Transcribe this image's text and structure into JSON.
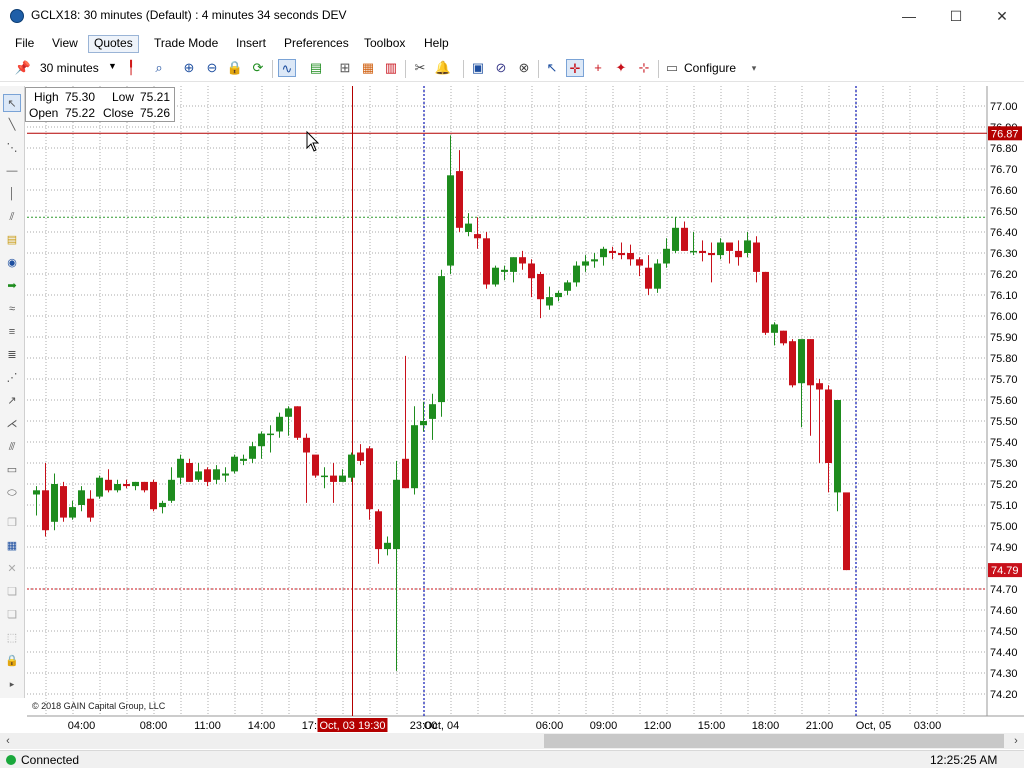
{
  "window": {
    "title": "GCLX18: 30 minutes (Default) : 4 minutes 34 seconds DEV",
    "minimize": "—",
    "maximize": "☐",
    "close": "✕"
  },
  "menu": [
    "File",
    "View",
    "Quotes",
    "Trade Mode",
    "Insert",
    "Preferences",
    "Toolbox",
    "Help"
  ],
  "menu_active": "Quotes",
  "toolbar": {
    "timeframe": "30 minutes",
    "configure_label": "Configure",
    "icons": [
      "pin-icon",
      "bar-type-icon",
      "zoom-icon",
      "zoom-in-icon",
      "zoom-out-icon",
      "lock-icon",
      "refresh-icon",
      "indicator-icon",
      "chart-type-icon",
      "tree-icon",
      "color-bars-icon",
      "bar-chart-icon",
      "scissors-icon",
      "alert-bell-icon",
      "book-icon",
      "link-icon",
      "unlink-icon",
      "cursor-icon",
      "crosshair-icon",
      "crosshair-alt-icon",
      "marker-icon",
      "cross-icon",
      "configure-icon"
    ]
  },
  "left_tools": [
    "select-icon",
    "line-icon",
    "parallel-line-icon",
    "horizontal-line-icon",
    "vertical-line-icon",
    "channel-icon",
    "note-icon",
    "callout-icon",
    "arrow-icon",
    "wave-icon",
    "fib-icon",
    "text-icon",
    "pitchfork-icon",
    "ray-icon",
    "gann-icon",
    "parallel-icon",
    "rectangle-icon",
    "ellipse-icon",
    "layers-icon",
    "properties-icon",
    "delete-icon",
    "copy-icon",
    "copy-all-icon",
    "select-all-icon",
    "lock-icon",
    "expand-icon"
  ],
  "ohlc": {
    "high_label": "High",
    "high": "75.30",
    "low_label": "Low",
    "low": "75.21",
    "open_label": "Open",
    "open": "75.22",
    "close_label": "Close",
    "close": "75.26"
  },
  "copyright": "© 2018 GAIN Capital Group, LLC",
  "status": {
    "connection": "Connected",
    "clock": "12:25:25 AM"
  },
  "colors": {
    "up": "#1e8c1e",
    "down": "#c8101a",
    "grid": "#8c8c8c",
    "price_tag": "#c8101a",
    "day_divider": "#0a14b4",
    "cursor_tag": "#b40000"
  },
  "chart_data": {
    "type": "candlestick",
    "symbol": "GCLX18",
    "interval": "30 minutes",
    "ylim": [
      74.15,
      77.05
    ],
    "y_ticks": [
      77.0,
      76.9,
      76.8,
      76.7,
      76.6,
      76.5,
      76.4,
      76.3,
      76.2,
      76.1,
      76.0,
      75.9,
      75.8,
      75.7,
      75.6,
      75.5,
      75.4,
      75.3,
      75.2,
      75.1,
      75.0,
      74.9,
      74.8,
      74.7,
      74.6,
      74.5,
      74.4,
      74.3,
      74.2
    ],
    "x_ticks": [
      {
        "label": "04:00",
        "bar": 5
      },
      {
        "label": "08:00",
        "bar": 13
      },
      {
        "label": "11:00",
        "bar": 19
      },
      {
        "label": "14:00",
        "bar": 25
      },
      {
        "label": "17:00",
        "bar": 31
      },
      {
        "label": "23:00",
        "bar": 43
      },
      {
        "label": "Oct, 04",
        "bar": 45
      },
      {
        "label": "06:00",
        "bar": 57
      },
      {
        "label": "09:00",
        "bar": 63
      },
      {
        "label": "12:00",
        "bar": 69
      },
      {
        "label": "15:00",
        "bar": 75
      },
      {
        "label": "18:00",
        "bar": 81
      },
      {
        "label": "21:00",
        "bar": 87
      },
      {
        "label": "Oct, 05",
        "bar": 93
      },
      {
        "label": "03:00",
        "bar": 99
      }
    ],
    "candles": [
      [
        75.15,
        75.19,
        75.05,
        75.17
      ],
      [
        75.17,
        75.3,
        74.95,
        74.98
      ],
      [
        75.02,
        75.25,
        74.98,
        75.2
      ],
      [
        75.19,
        75.21,
        75.02,
        75.04
      ],
      [
        75.04,
        75.12,
        75.03,
        75.09
      ],
      [
        75.1,
        75.19,
        75.07,
        75.17
      ],
      [
        75.13,
        75.17,
        75.02,
        75.04
      ],
      [
        75.14,
        75.24,
        75.13,
        75.23
      ],
      [
        75.22,
        75.27,
        75.16,
        75.17
      ],
      [
        75.17,
        75.22,
        75.16,
        75.2
      ],
      [
        75.2,
        75.22,
        75.18,
        75.19
      ],
      [
        75.19,
        75.21,
        75.17,
        75.21
      ],
      [
        75.21,
        75.21,
        75.16,
        75.17
      ],
      [
        75.21,
        75.22,
        75.07,
        75.08
      ],
      [
        75.09,
        75.12,
        75.06,
        75.11
      ],
      [
        75.12,
        75.28,
        75.11,
        75.22
      ],
      [
        75.23,
        75.34,
        75.2,
        75.32
      ],
      [
        75.3,
        75.32,
        75.21,
        75.21
      ],
      [
        75.22,
        75.3,
        75.21,
        75.26
      ],
      [
        75.27,
        75.28,
        75.19,
        75.21
      ],
      [
        75.22,
        75.29,
        75.2,
        75.27
      ],
      [
        75.24,
        75.28,
        75.21,
        75.25
      ],
      [
        75.26,
        75.34,
        75.25,
        75.33
      ],
      [
        75.31,
        75.34,
        75.29,
        75.32
      ],
      [
        75.32,
        75.4,
        75.3,
        75.38
      ],
      [
        75.38,
        75.45,
        75.32,
        75.44
      ],
      [
        75.44,
        75.48,
        75.35,
        75.44
      ],
      [
        75.45,
        75.54,
        75.42,
        75.52
      ],
      [
        75.52,
        75.57,
        75.43,
        75.56
      ],
      [
        75.57,
        75.57,
        75.41,
        75.42
      ],
      [
        75.42,
        75.44,
        75.11,
        75.35
      ],
      [
        75.34,
        75.33,
        75.23,
        75.24
      ],
      [
        75.24,
        75.28,
        75.18,
        75.24
      ],
      [
        75.24,
        75.3,
        75.11,
        75.21
      ],
      [
        75.21,
        75.27,
        75.21,
        75.24
      ],
      [
        75.23,
        75.35,
        75.21,
        75.34
      ],
      [
        75.35,
        75.39,
        75.29,
        75.31
      ],
      [
        75.37,
        75.38,
        75.03,
        75.08
      ],
      [
        75.07,
        75.08,
        74.82,
        74.89
      ],
      [
        74.89,
        74.95,
        74.86,
        74.92
      ],
      [
        74.89,
        75.31,
        74.31,
        75.22
      ],
      [
        75.32,
        75.81,
        75.18,
        75.18
      ],
      [
        75.18,
        75.57,
        75.15,
        75.48
      ],
      [
        75.48,
        75.59,
        75.45,
        75.5
      ],
      [
        75.51,
        75.63,
        75.41,
        75.58
      ],
      [
        75.59,
        76.22,
        75.52,
        76.19
      ],
      [
        76.24,
        76.86,
        76.2,
        76.67
      ],
      [
        76.69,
        76.79,
        76.4,
        76.42
      ],
      [
        76.4,
        76.49,
        76.38,
        76.44
      ],
      [
        76.39,
        76.47,
        76.32,
        76.37
      ],
      [
        76.37,
        76.4,
        76.13,
        76.15
      ],
      [
        76.15,
        76.24,
        76.14,
        76.23
      ],
      [
        76.21,
        76.24,
        76.17,
        76.22
      ],
      [
        76.21,
        76.28,
        76.16,
        76.28
      ],
      [
        76.28,
        76.31,
        76.22,
        76.25
      ],
      [
        76.25,
        76.27,
        76.09,
        76.18
      ],
      [
        76.2,
        76.21,
        75.99,
        76.08
      ],
      [
        76.05,
        76.14,
        76.03,
        76.09
      ],
      [
        76.09,
        76.12,
        76.07,
        76.11
      ],
      [
        76.12,
        76.17,
        76.1,
        76.16
      ],
      [
        76.16,
        76.26,
        76.14,
        76.24
      ],
      [
        76.24,
        76.29,
        76.21,
        76.26
      ],
      [
        76.26,
        76.3,
        76.23,
        76.27
      ],
      [
        76.28,
        76.33,
        76.24,
        76.32
      ],
      [
        76.31,
        76.33,
        76.27,
        76.3
      ],
      [
        76.3,
        76.35,
        76.27,
        76.29
      ],
      [
        76.3,
        76.34,
        76.24,
        76.27
      ],
      [
        76.27,
        76.28,
        76.19,
        76.24
      ],
      [
        76.23,
        76.29,
        76.1,
        76.13
      ],
      [
        76.13,
        76.27,
        76.11,
        76.25
      ],
      [
        76.25,
        76.37,
        76.23,
        76.32
      ],
      [
        76.31,
        76.47,
        76.3,
        76.42
      ],
      [
        76.42,
        76.45,
        76.31,
        76.31
      ],
      [
        76.31,
        76.4,
        76.29,
        76.31
      ],
      [
        76.31,
        76.36,
        76.26,
        76.3
      ],
      [
        76.3,
        76.35,
        76.16,
        76.29
      ],
      [
        76.29,
        76.37,
        76.27,
        76.35
      ],
      [
        76.35,
        76.35,
        76.25,
        76.31
      ],
      [
        76.31,
        76.36,
        76.24,
        76.28
      ],
      [
        76.3,
        76.4,
        76.28,
        76.36
      ],
      [
        76.35,
        76.38,
        76.16,
        76.21
      ],
      [
        76.21,
        76.21,
        75.91,
        75.92
      ],
      [
        75.92,
        75.97,
        75.86,
        75.96
      ],
      [
        75.93,
        75.93,
        75.86,
        75.87
      ],
      [
        75.88,
        75.89,
        75.66,
        75.67
      ],
      [
        75.68,
        75.88,
        75.47,
        75.89
      ],
      [
        75.89,
        75.89,
        75.43,
        75.67
      ],
      [
        75.68,
        75.7,
        75.3,
        75.65
      ],
      [
        75.65,
        75.67,
        75.16,
        75.3
      ],
      [
        75.16,
        75.6,
        75.07,
        75.6
      ],
      [
        75.16,
        75.15,
        74.79,
        74.79
      ]
    ],
    "last_price": 74.79,
    "cursor_price": 76.87,
    "cursor_time_label": "Oct, 03 19:30",
    "cursor_bar": 35,
    "h_levels": [
      {
        "price": 76.47,
        "color": "#2e9a2e",
        "style": "dotted"
      },
      {
        "price": 74.7,
        "color": "#c8101a",
        "style": "dotted"
      }
    ],
    "day_dividers": [
      43,
      91
    ],
    "grid": true
  }
}
